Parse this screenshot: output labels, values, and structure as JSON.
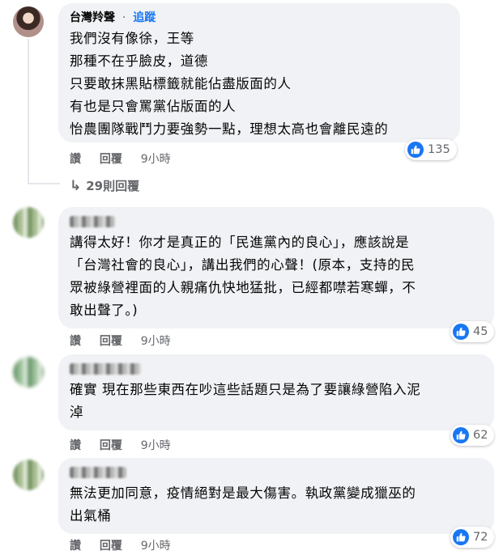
{
  "comments": [
    {
      "author": "台灣羚聲",
      "follow_label": "追蹤",
      "text": "我們沒有像徐，王等\n那種不在乎臉皮，道德\n只要敢抹黑貼標籤就能佔盡版面的人\n有也是只會罵黨佔版面的人\n怡農團隊戰鬥力要強勢一點，理想太高也會離民遠的",
      "like": "讚",
      "reply": "回覆",
      "time": "9小時",
      "reactions": "135",
      "view_replies": "29則回覆"
    },
    {
      "text": "講得太好！你才是真正的「民進黨內的良心」，應該說是\n「台灣社會的良心」，講出我們的心聲！(原本，支持的民\n眾被綠營裡面的人親痛仇快地猛批，已經都噤若寒蟬，不\n敢出聲了。)",
      "like": "讚",
      "reply": "回覆",
      "time": "9小時",
      "reactions": "45"
    },
    {
      "text": "確實 現在那些東西在吵這些話題只是為了要讓綠營陷入泥\n淖",
      "like": "讚",
      "reply": "回覆",
      "time": "9小時",
      "reactions": "62"
    },
    {
      "text": "無法更加同意，疫情絕對是最大傷害。執政黨變成獵巫的\n出氣桶",
      "like": "讚",
      "reply": "回覆",
      "time": "9小時",
      "reactions": "72"
    }
  ]
}
